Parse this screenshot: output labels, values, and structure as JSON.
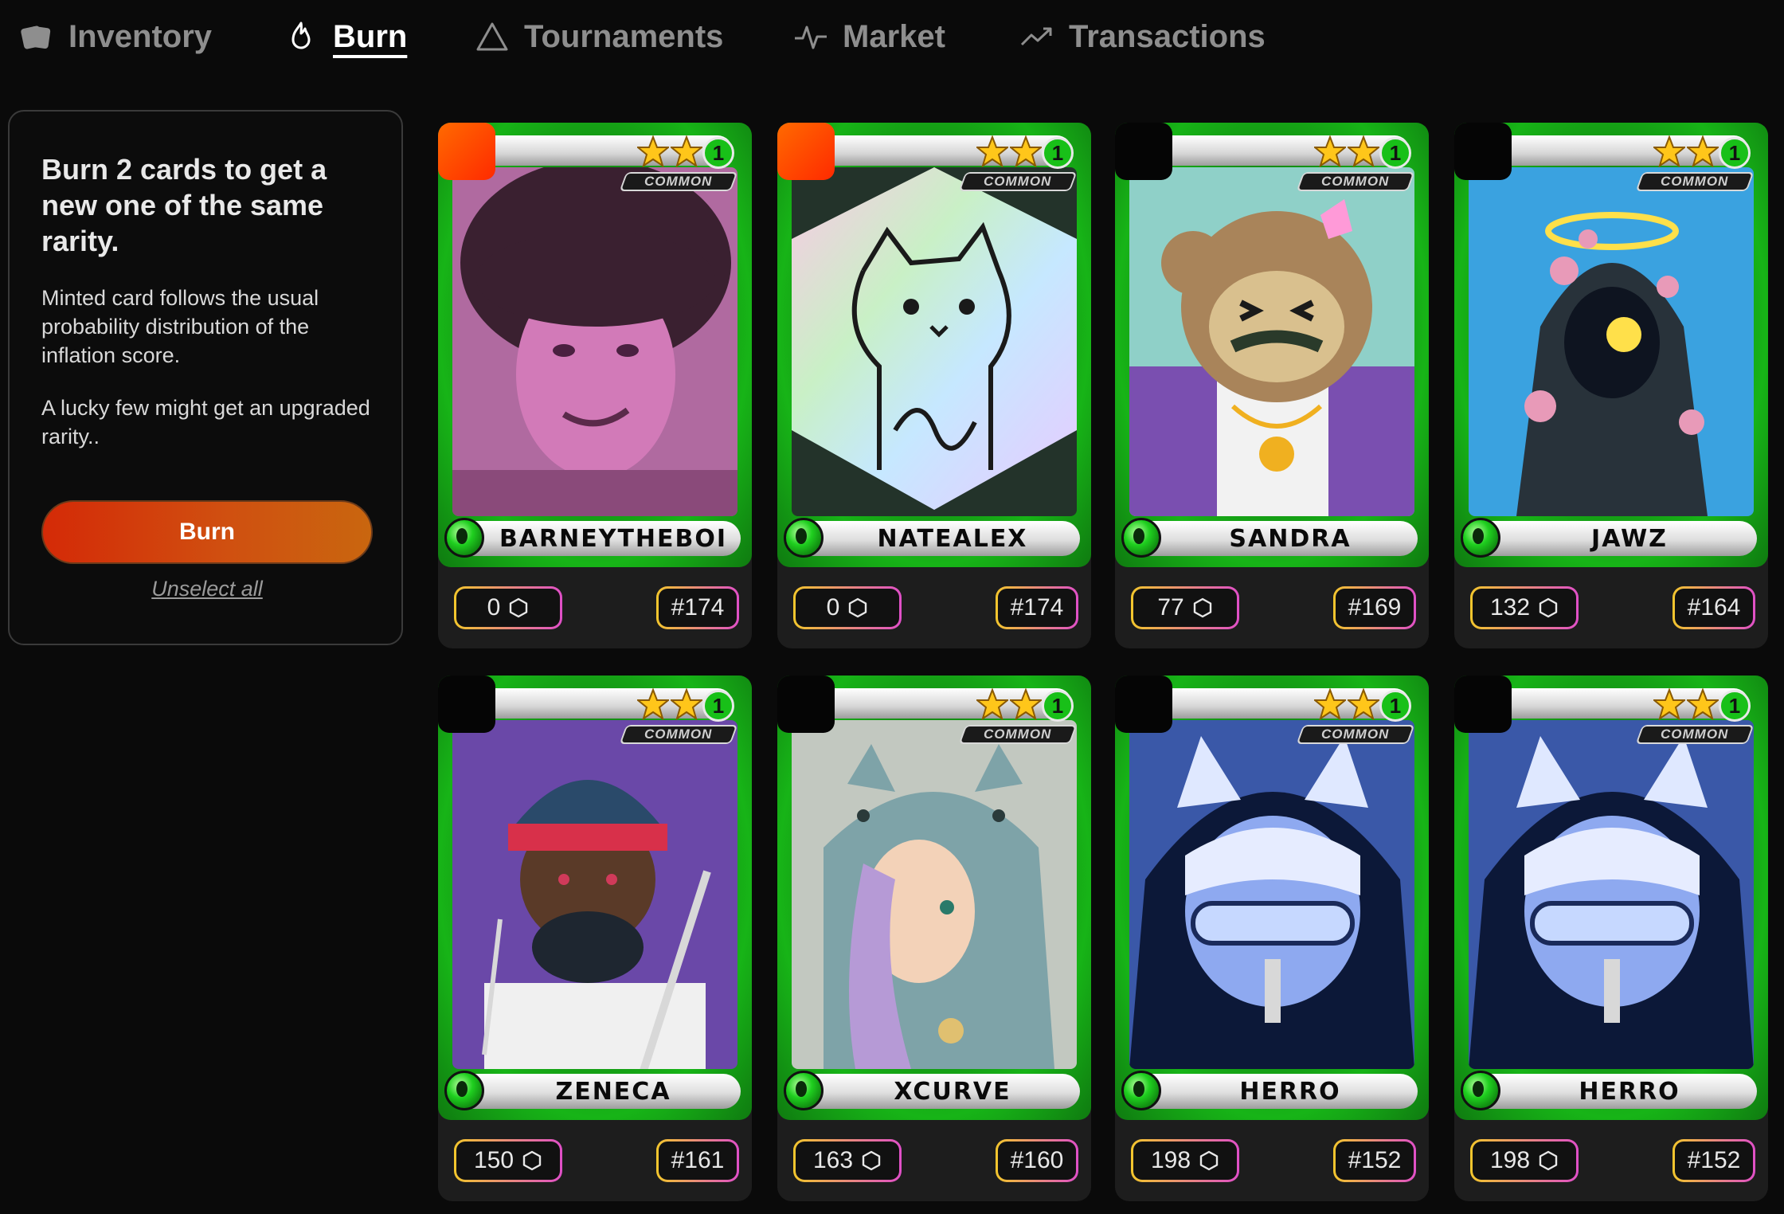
{
  "nav": {
    "items": [
      {
        "label": "Inventory",
        "icon": "cards-icon",
        "active": false
      },
      {
        "label": "Burn",
        "icon": "flame-icon",
        "active": true
      },
      {
        "label": "Tournaments",
        "icon": "triangle-icon",
        "active": false
      },
      {
        "label": "Market",
        "icon": "activity-icon",
        "active": false
      },
      {
        "label": "Transactions",
        "icon": "trend-up-icon",
        "active": false
      }
    ]
  },
  "panel": {
    "title": "Burn 2 cards to get a new one of the same rarity.",
    "paragraph1": "Minted card follows the usual probability distribution of the inflation score.",
    "paragraph2": "A lucky few might get an upgraded rarity..",
    "burn_button": "Burn",
    "unselect_link": "Unselect all"
  },
  "colors": {
    "accent_orange": "#d9480f",
    "card_green": "#17b417",
    "pill_gradient_start": "#f2c62c",
    "pill_gradient_end": "#e04fc8"
  },
  "cards": [
    {
      "name": "BARNEYTHEBOI",
      "rarity": "COMMON",
      "level": "1",
      "stars": 2,
      "score": "0",
      "id": "#174",
      "selected": true,
      "art": "portrait-pink"
    },
    {
      "name": "NATEALEX",
      "rarity": "COMMON",
      "level": "1",
      "stars": 2,
      "score": "0",
      "id": "#174",
      "selected": true,
      "art": "rainbow-cat"
    },
    {
      "name": "SANDRA",
      "rarity": "COMMON",
      "level": "1",
      "stars": 2,
      "score": "77",
      "id": "#169",
      "selected": false,
      "art": "monkey"
    },
    {
      "name": "JAWZ",
      "rarity": "COMMON",
      "level": "1",
      "stars": 2,
      "score": "132",
      "id": "#164",
      "selected": false,
      "art": "hooded-halo"
    },
    {
      "name": "ZENECA",
      "rarity": "COMMON",
      "level": "1",
      "stars": 2,
      "score": "150",
      "id": "#161",
      "selected": false,
      "art": "samurai"
    },
    {
      "name": "XCURVE",
      "rarity": "COMMON",
      "level": "1",
      "stars": 2,
      "score": "163",
      "id": "#160",
      "selected": false,
      "art": "cat-hood"
    },
    {
      "name": "HERRO",
      "rarity": "COMMON",
      "level": "1",
      "stars": 2,
      "score": "198",
      "id": "#152",
      "selected": false,
      "art": "blue-hood"
    },
    {
      "name": "HERRO",
      "rarity": "COMMON",
      "level": "1",
      "stars": 2,
      "score": "198",
      "id": "#152",
      "selected": false,
      "art": "blue-hood"
    }
  ]
}
